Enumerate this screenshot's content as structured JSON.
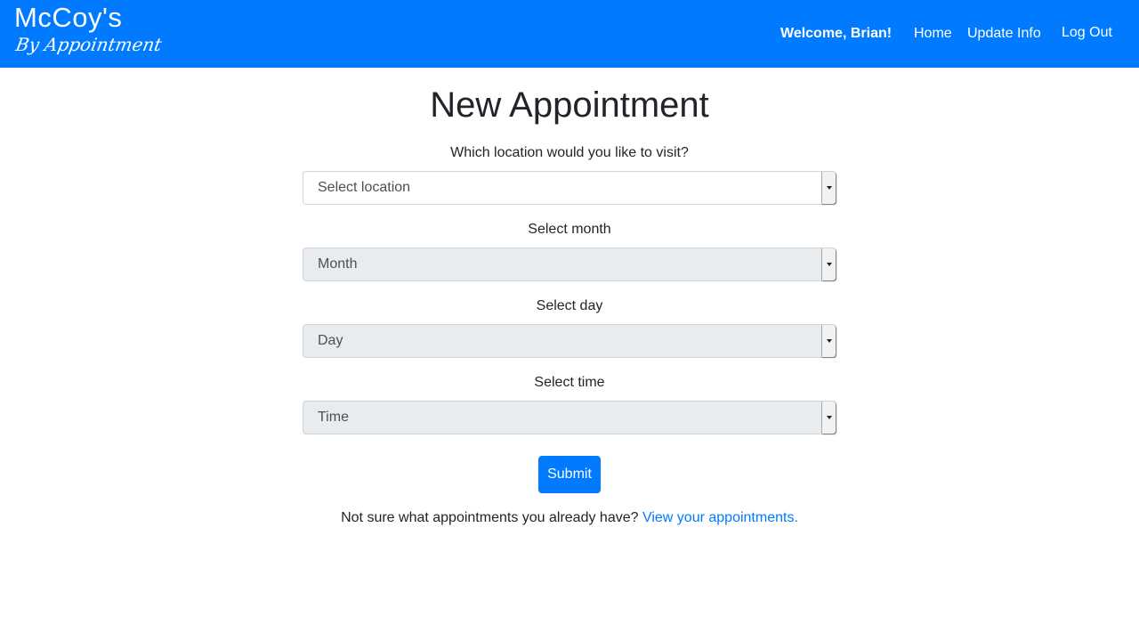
{
  "navbar": {
    "brand_name": "McCoy's",
    "brand_tagline": "By Appointment",
    "welcome": "Welcome, Brian!",
    "links": {
      "home": "Home",
      "update_info": "Update Info",
      "log_out": "Log Out"
    },
    "color": "#007bff"
  },
  "main": {
    "title": "New Appointment",
    "location": {
      "label": "Which location would you like to visit?",
      "value": "Select location"
    },
    "month": {
      "label": "Select month",
      "value": "Month"
    },
    "day": {
      "label": "Select day",
      "value": "Day"
    },
    "time": {
      "label": "Select time",
      "value": "Time"
    },
    "submit_label": "Submit",
    "footer_text": "Not sure what appointments you already have?",
    "footer_link": "View your appointments."
  }
}
